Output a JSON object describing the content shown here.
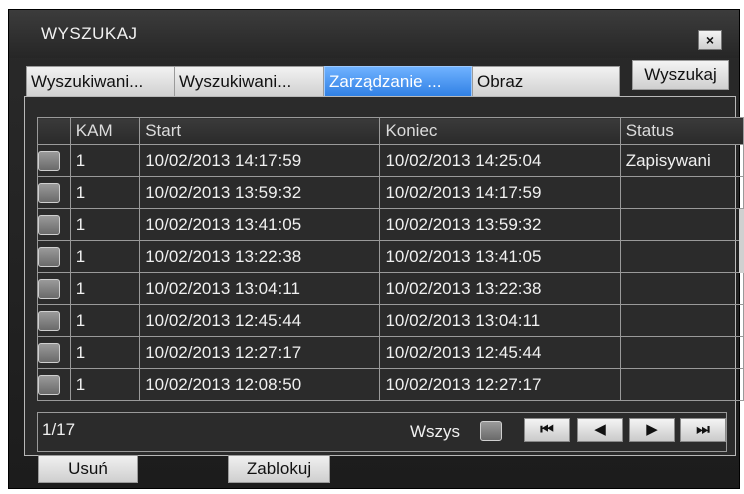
{
  "window": {
    "title": "WYSZUKAJ",
    "close_icon": "×"
  },
  "tabs": [
    {
      "label": "Wyszukiwani...",
      "active": false
    },
    {
      "label": "Wyszukiwani...",
      "active": false
    },
    {
      "label": "Zarządzanie ...",
      "active": true
    },
    {
      "label": "Obraz",
      "active": false
    }
  ],
  "search_button": "Wyszukaj",
  "table": {
    "headers": [
      "KAM",
      "Start",
      "Koniec",
      "Status"
    ],
    "rows": [
      {
        "kam": "1",
        "start": "10/02/2013 14:17:59",
        "end": "10/02/2013 14:25:04",
        "status": "Zapisywani"
      },
      {
        "kam": "1",
        "start": "10/02/2013 13:59:32",
        "end": "10/02/2013 14:17:59",
        "status": ""
      },
      {
        "kam": "1",
        "start": "10/02/2013 13:41:05",
        "end": "10/02/2013 13:59:32",
        "status": ""
      },
      {
        "kam": "1",
        "start": "10/02/2013 13:22:38",
        "end": "10/02/2013 13:41:05",
        "status": ""
      },
      {
        "kam": "1",
        "start": "10/02/2013 13:04:11",
        "end": "10/02/2013 13:22:38",
        "status": ""
      },
      {
        "kam": "1",
        "start": "10/02/2013 12:45:44",
        "end": "10/02/2013 13:04:11",
        "status": ""
      },
      {
        "kam": "1",
        "start": "10/02/2013 12:27:17",
        "end": "10/02/2013 12:45:44",
        "status": ""
      },
      {
        "kam": "1",
        "start": "10/02/2013 12:08:50",
        "end": "10/02/2013 12:27:17",
        "status": ""
      }
    ]
  },
  "footer": {
    "page": "1/17",
    "select_all_label": "Wszys",
    "nav": {
      "first": "⏮",
      "prev": "◀",
      "next": "▶",
      "last": "⏭"
    }
  },
  "actions": {
    "delete": "Usuń",
    "lock": "Zablokuj"
  },
  "colors": {
    "active_tab": "#2f7fe4",
    "background": "#1c1c1c"
  }
}
